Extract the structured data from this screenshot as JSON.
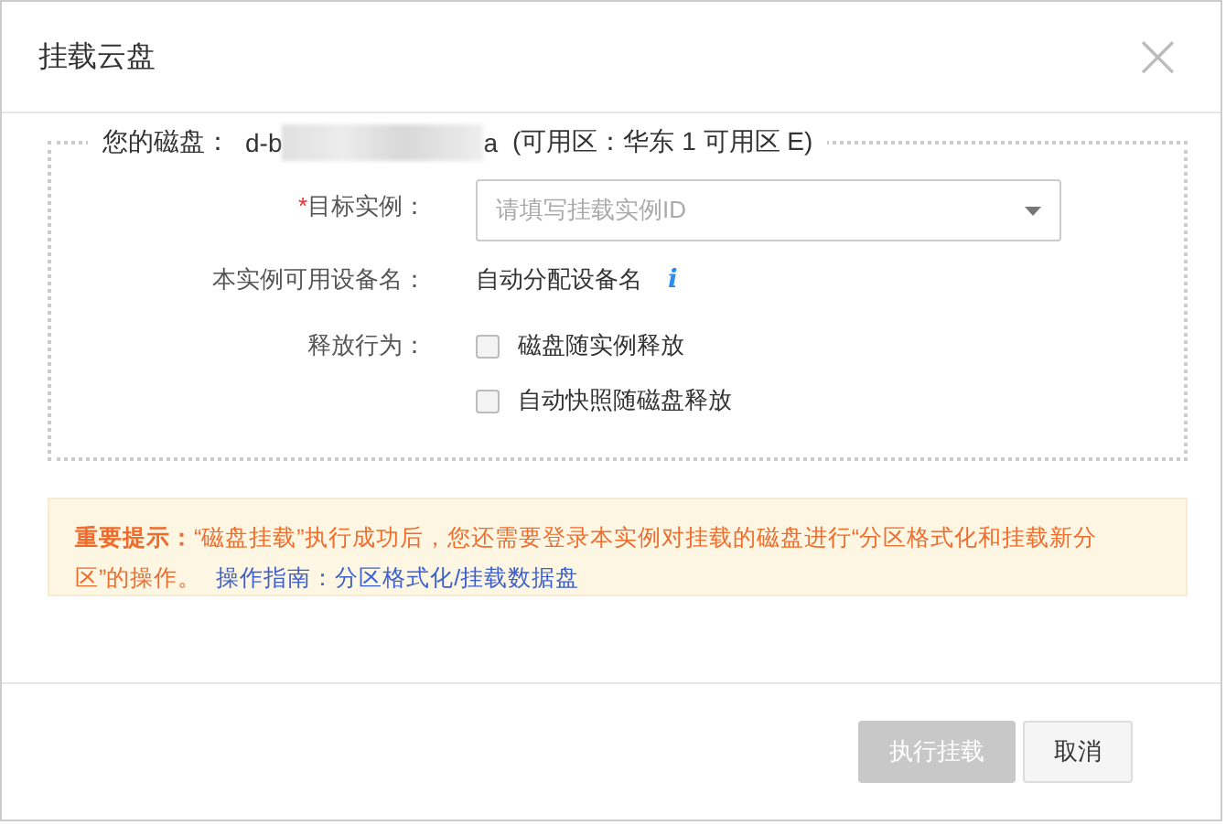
{
  "dialog": {
    "title": "挂载云盘",
    "close_icon": "×",
    "disk": {
      "label": "您的磁盘：",
      "id_prefix": "d-b",
      "id_suffix": "a",
      "zone": "(可用区：华东 1 可用区 E)"
    },
    "fields": [
      {
        "kind": "select",
        "label": "目标实例：",
        "required_mark": "*",
        "placeholder": "请填写挂载实例ID"
      },
      {
        "kind": "text",
        "label": "本实例可用设备名：",
        "value": "自动分配设备名",
        "info_icon": "i"
      },
      {
        "kind": "checkboxes",
        "label": "释放行为：",
        "options": [
          {
            "label": "磁盘随实例释放",
            "checked": false
          },
          {
            "label": "自动快照随磁盘释放",
            "checked": false
          }
        ]
      }
    ],
    "notice": {
      "text": "**重要提示：**“磁盘挂载”执行成功后，您还需要登录本实例对挂载的磁盘进行“分区格式化和挂载新分区”的操作。",
      "link": "操作指南：分区格式化/挂载数据盘"
    },
    "buttons": [
      {
        "label": "执行挂载",
        "disabled": true
      },
      {
        "label": "取消",
        "disabled": false
      }
    ]
  }
}
